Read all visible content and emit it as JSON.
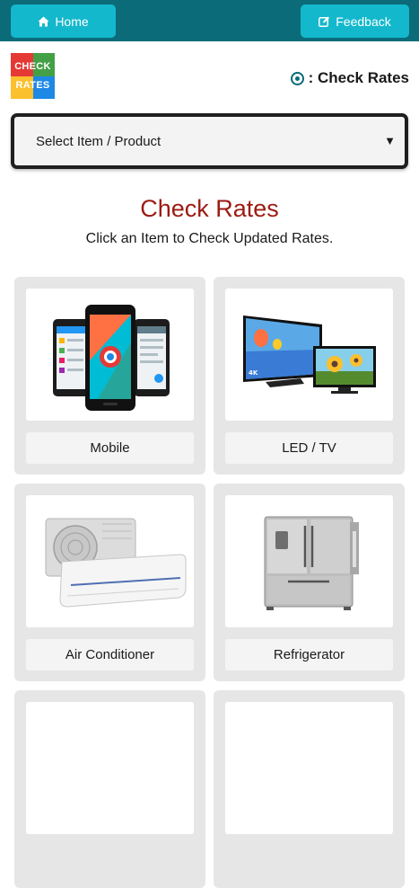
{
  "header": {
    "home_label": "Home",
    "feedback_label": "Feedback",
    "bar_color": "#0b6b78",
    "button_color": "#14b8cc"
  },
  "logo": {
    "line1": "CHECK",
    "line2": "RATES"
  },
  "page_heading": ": Check Rates",
  "select": {
    "value": "Select Item / Product"
  },
  "main": {
    "title": "Check Rates",
    "subtitle": "Click an Item to Check Updated Rates.",
    "title_color": "#9c1b12"
  },
  "categories": [
    {
      "label": "Mobile",
      "icon": "mobile-phones-image"
    },
    {
      "label": "LED / TV",
      "icon": "led-tv-image"
    },
    {
      "label": "Air Conditioner",
      "icon": "air-conditioner-image"
    },
    {
      "label": "Refrigerator",
      "icon": "refrigerator-image"
    },
    {
      "label": "",
      "icon": "partial-card"
    },
    {
      "label": "",
      "icon": "partial-card"
    }
  ]
}
